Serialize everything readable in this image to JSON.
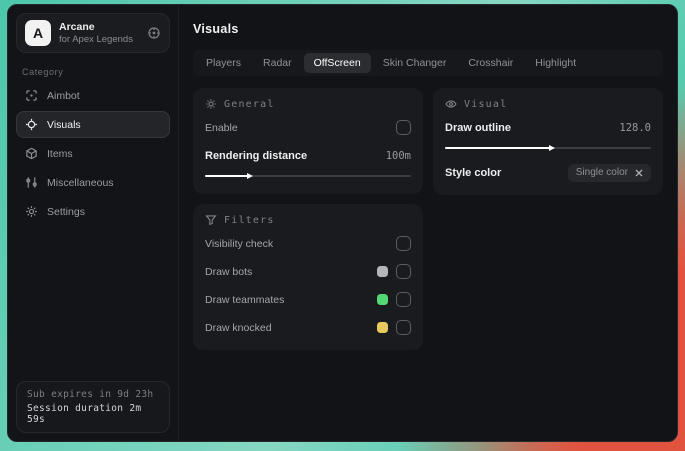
{
  "app": {
    "name": "Arcane",
    "subtitle": "for Apex Legends",
    "logo_letter": "A"
  },
  "sidebar": {
    "category_label": "Category",
    "items": [
      {
        "label": "Aimbot"
      },
      {
        "label": "Visuals",
        "active": true
      },
      {
        "label": "Items"
      },
      {
        "label": "Miscellaneous"
      },
      {
        "label": "Settings"
      }
    ],
    "footer": {
      "sub_expiry": "Sub expires in 9d 23h",
      "session_duration": "Session duration 2m 59s"
    }
  },
  "main": {
    "title": "Visuals",
    "active_tab": "OffScreen",
    "tabs": [
      {
        "label": "Players"
      },
      {
        "label": "Radar"
      },
      {
        "label": "OffScreen"
      },
      {
        "label": "Skin Changer"
      },
      {
        "label": "Crosshair"
      },
      {
        "label": "Highlight"
      }
    ]
  },
  "general_card": {
    "title": "General",
    "enable_label": "Enable",
    "enable_checked": false,
    "rendering_distance_label": "Rendering distance",
    "rendering_distance_value": "100m",
    "rendering_distance_fill_pct": 21
  },
  "visual_card": {
    "title": "Visual",
    "draw_outline_label": "Draw outline",
    "draw_outline_value": "128.0",
    "draw_outline_fill_pct": 51,
    "style_color_label": "Style color",
    "style_color_selected": "Single color"
  },
  "filters_card": {
    "title": "Filters",
    "rows": [
      {
        "label": "Visibility check",
        "checked": false
      },
      {
        "label": "Draw bots",
        "color": "#b3b5b7",
        "checked": false
      },
      {
        "label": "Draw teammates",
        "color": "#55d873",
        "checked": false
      },
      {
        "label": "Draw knocked",
        "color": "#e8c95e",
        "checked": false
      }
    ]
  },
  "colors": {
    "accent_teal": "#4cc7ab",
    "accent_red": "#e2533f",
    "active_tab_bg": "#2b2d31"
  }
}
